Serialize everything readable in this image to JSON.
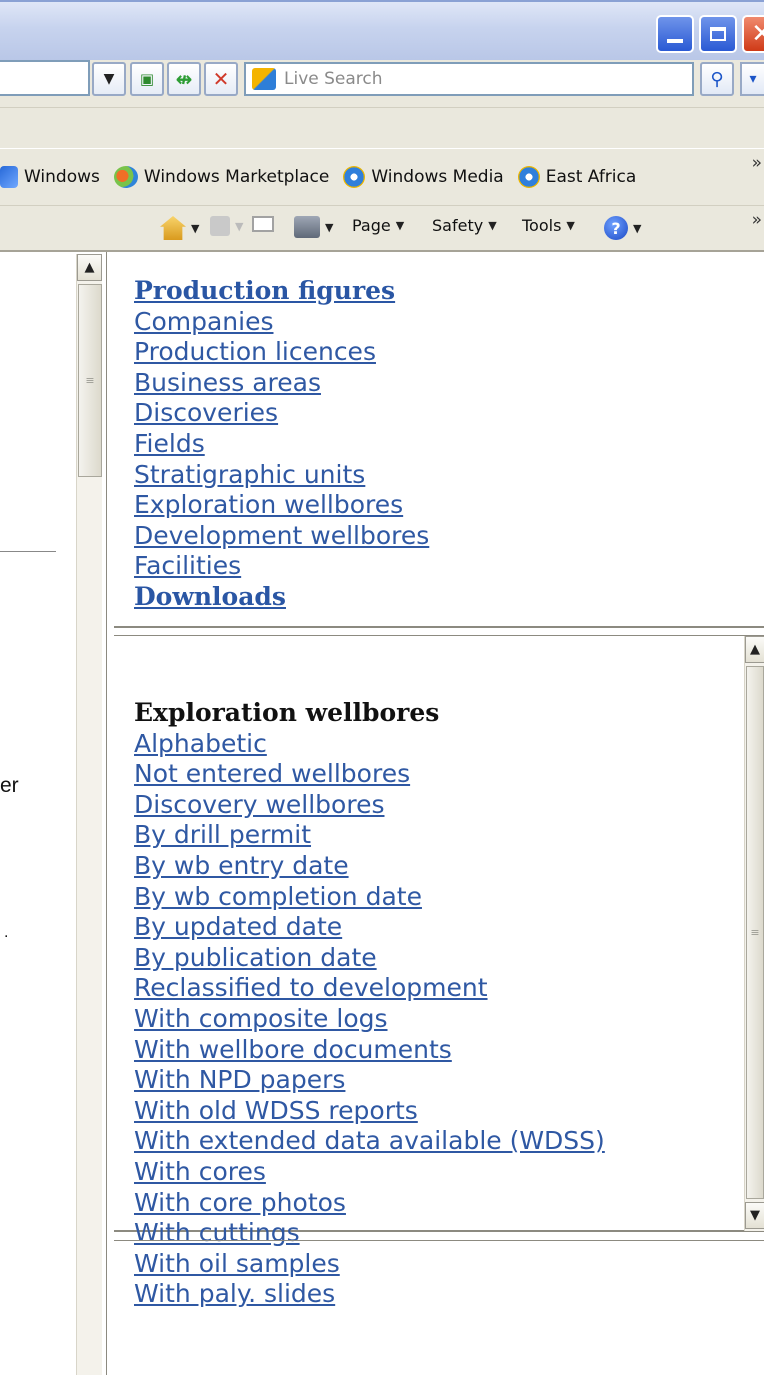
{
  "toolbar": {
    "search_placeholder": "Live Search"
  },
  "links_bar": {
    "items": [
      "Windows",
      "Windows Marketplace",
      "Windows Media",
      "East Africa"
    ],
    "overflow": "»"
  },
  "command_bar": {
    "page_label": "Page",
    "safety_label": "Safety",
    "tools_label": "Tools",
    "overflow": "»"
  },
  "left_frame": {
    "fragment_1": "er",
    "fragment_2": "."
  },
  "nav_menu": {
    "items": [
      {
        "label": "Production figures"
      },
      {
        "label": "Companies"
      },
      {
        "label": "Production licences"
      },
      {
        "label": "Business areas"
      },
      {
        "label": "Discoveries"
      },
      {
        "label": "Fields"
      },
      {
        "label": "Stratigraphic units"
      },
      {
        "label": "Exploration wellbores"
      },
      {
        "label": "Development wellbores"
      },
      {
        "label": "Facilities"
      },
      {
        "label": "Downloads"
      }
    ]
  },
  "submenu": {
    "heading": "Exploration wellbores",
    "items": [
      "Alphabetic",
      "Not entered wellbores",
      "Discovery wellbores",
      "By drill permit",
      "By wb entry date",
      "By wb completion date",
      "By updated date",
      "By publication date",
      "Reclassified to development",
      "With composite logs",
      "With wellbore documents",
      "With NPD papers",
      "With old WDSS reports",
      "With extended data available (WDSS)",
      "With cores",
      "With core photos",
      "With cuttings",
      "With oil samples",
      "With paly. slides"
    ]
  }
}
